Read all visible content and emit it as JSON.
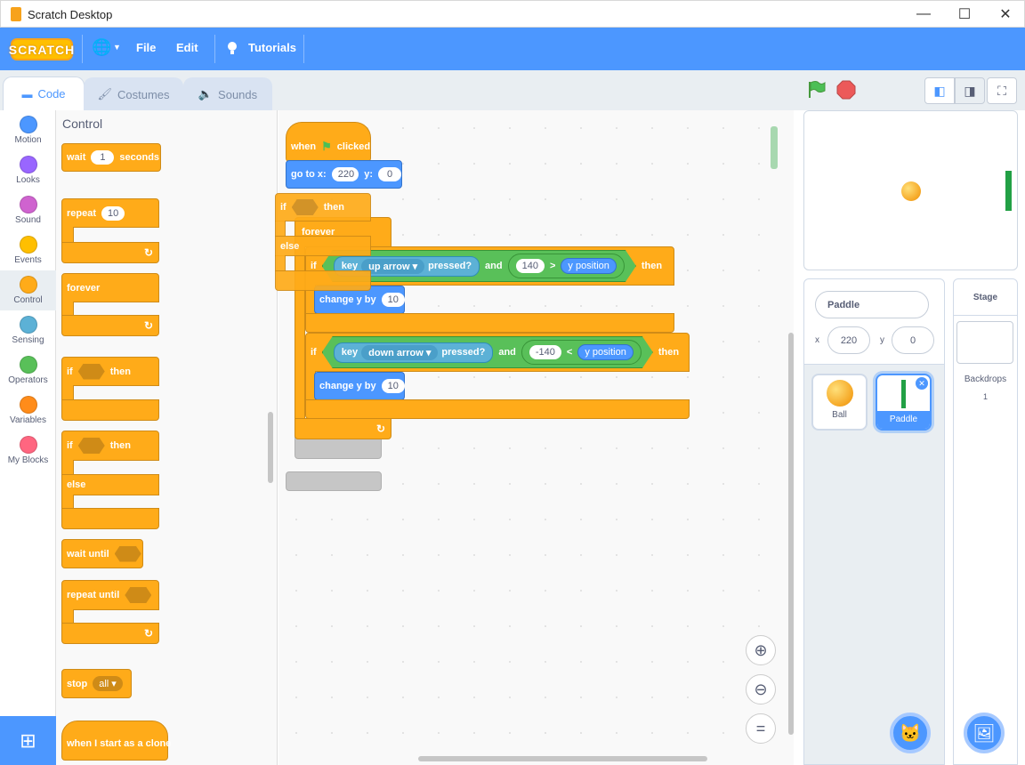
{
  "window": {
    "title": "Scratch Desktop",
    "minimize": "—",
    "maximize": "☐",
    "close": "✕"
  },
  "menu": {
    "logo": "SCRATCH",
    "language_icon": "🌐",
    "file": "File",
    "edit": "Edit",
    "tutorials": "Tutorials"
  },
  "tabs": [
    {
      "label": "Code",
      "icon": "code-icon"
    },
    {
      "label": "Costumes",
      "icon": "brush-icon"
    },
    {
      "label": "Sounds",
      "icon": "speaker-icon"
    }
  ],
  "categories": [
    {
      "label": "Motion",
      "color": "#4c97ff"
    },
    {
      "label": "Looks",
      "color": "#9966ff"
    },
    {
      "label": "Sound",
      "color": "#cf63cf"
    },
    {
      "label": "Events",
      "color": "#ffbf00"
    },
    {
      "label": "Control",
      "color": "#ffab19"
    },
    {
      "label": "Sensing",
      "color": "#5cb1d6"
    },
    {
      "label": "Operators",
      "color": "#59c059"
    },
    {
      "label": "Variables",
      "color": "#ff8c1a"
    },
    {
      "label": "My Blocks",
      "color": "#ff6680"
    }
  ],
  "palette": {
    "title": "Control",
    "wait": {
      "label": "wait",
      "value": "1",
      "unit": "seconds"
    },
    "repeat": {
      "label": "repeat",
      "value": "10"
    },
    "forever": "forever",
    "if_then": {
      "if": "if",
      "then": "then"
    },
    "if_else": {
      "if": "if",
      "then": "then",
      "else": "else"
    },
    "wait_until": "wait until",
    "repeat_until": "repeat until",
    "stop": {
      "label": "stop",
      "option": "all"
    },
    "clone_hat": "when I start as a clone"
  },
  "script": {
    "hat": {
      "when": "when",
      "clicked": "clicked"
    },
    "goto": {
      "label": "go to x:",
      "x": "220",
      "ylabel": "y:",
      "y": "0"
    },
    "drag_if": {
      "if": "if",
      "then": "then",
      "else": "else"
    },
    "forever": "forever",
    "if1": {
      "if": "if",
      "key": "key",
      "option": "up arrow",
      "pressed": "pressed?",
      "and": "and",
      "num": "140",
      "op": ">",
      "reporter": "y position",
      "then": "then"
    },
    "change1": {
      "label": "change y by",
      "value": "10"
    },
    "if2": {
      "if": "if",
      "key": "key",
      "option": "down arrow",
      "pressed": "pressed?",
      "and": "and",
      "num": "-140",
      "op": "<",
      "reporter": "y position",
      "then": "then"
    },
    "change2": {
      "label": "change y by",
      "value": "10"
    }
  },
  "stage_controls": {
    "flag": "green-flag-icon",
    "stop": "stop-icon"
  },
  "sprite_info": {
    "name": "Paddle",
    "x_label": "x",
    "x": "220",
    "y_label": "y",
    "y": "0"
  },
  "sprites": [
    {
      "name": "Ball"
    },
    {
      "name": "Paddle"
    }
  ],
  "stage_panel": {
    "title": "Stage",
    "backdrops_label": "Backdrops",
    "backdrops_count": "1"
  }
}
